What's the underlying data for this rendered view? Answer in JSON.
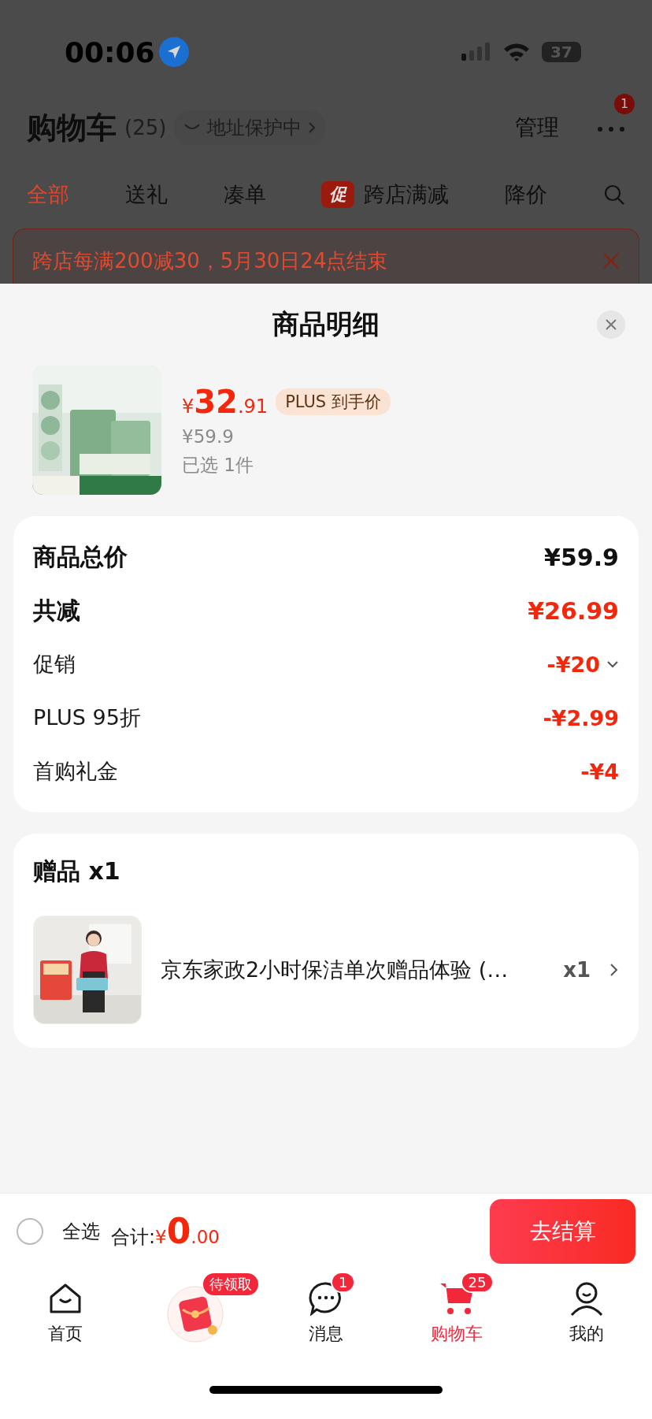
{
  "status_bar": {
    "time": "00:06",
    "battery": "37"
  },
  "header": {
    "title": "购物车",
    "count": "(25)",
    "address": "地址保护中",
    "manage": "管理",
    "more_badge": "1"
  },
  "tabs": [
    {
      "label": "全部",
      "selected": true
    },
    {
      "label": "送礼",
      "selected": false
    },
    {
      "label": "凑单",
      "selected": false
    },
    {
      "label": "跨店满减",
      "tag": "促",
      "selected": false
    },
    {
      "label": "降价",
      "selected": false
    }
  ],
  "banner": {
    "text": "跨店每满200减30，5月30日24点结束"
  },
  "sheet": {
    "title": "商品明细",
    "product": {
      "currency": "¥",
      "price_int": "32",
      "price_dec": ".91",
      "badge": "PLUS 到手价",
      "original_price": "¥59.9",
      "selected_count": "已选 1件"
    },
    "summary": [
      {
        "kind": "total",
        "label": "商品总价",
        "value": "¥59.9"
      },
      {
        "kind": "saving",
        "label": "共减",
        "value": "¥26.99"
      },
      {
        "kind": "detail",
        "label": "促销",
        "value": "-¥20",
        "expandable": true
      },
      {
        "kind": "detail",
        "label": "PLUS 95折",
        "value": "-¥2.99",
        "expandable": false
      },
      {
        "kind": "detail",
        "label": "首购礼金",
        "value": "-¥4",
        "expandable": false
      }
    ],
    "gifts": {
      "title": "赠品 x1",
      "items": [
        {
          "name": "京东家政2小时保洁单次赠品体验 (…",
          "quantity": "x1"
        }
      ]
    }
  },
  "checkout": {
    "select_all": {
      "label": "全选",
      "checked": false
    },
    "total_label": "合计:",
    "currency": "¥",
    "total_int": "0",
    "total_dec": ".00",
    "button": "去结算"
  },
  "tab_bar": [
    {
      "kind": "home",
      "label": "首页",
      "selected": false
    },
    {
      "kind": "promo",
      "badge": "待领取"
    },
    {
      "kind": "message",
      "label": "消息",
      "badge": "1",
      "selected": false
    },
    {
      "kind": "cart",
      "label": "购物车",
      "badge": "25",
      "selected": true
    },
    {
      "kind": "person",
      "label": "我的",
      "selected": false
    }
  ]
}
